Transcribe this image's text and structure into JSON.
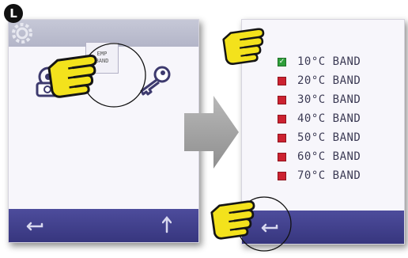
{
  "step": {
    "letter": "L"
  },
  "left_screen": {
    "tile_label_line1": "EMP",
    "tile_label_line2": "BAND"
  },
  "right_screen": {
    "bands": [
      {
        "label": "10°C BAND",
        "checked": true
      },
      {
        "label": "20°C BAND",
        "checked": false
      },
      {
        "label": "30°C BAND",
        "checked": false
      },
      {
        "label": "40°C BAND",
        "checked": false
      },
      {
        "label": "50°C BAND",
        "checked": false
      },
      {
        "label": "60°C BAND",
        "checked": false
      },
      {
        "label": "70°C BAND",
        "checked": false
      }
    ]
  },
  "colors": {
    "bar": "#3f3e88",
    "checked": "#2f9f3a",
    "unchecked": "#cc2230",
    "pointer_hand": "#f3e21c",
    "arrow": "#a3a3a3"
  },
  "icons": [
    "gear-icon",
    "camera-gear-icon",
    "temp-band-tile",
    "key-icon",
    "back-arrow-icon",
    "up-arrow-icon",
    "pointer-hand-icon",
    "right-arrow-icon"
  ]
}
